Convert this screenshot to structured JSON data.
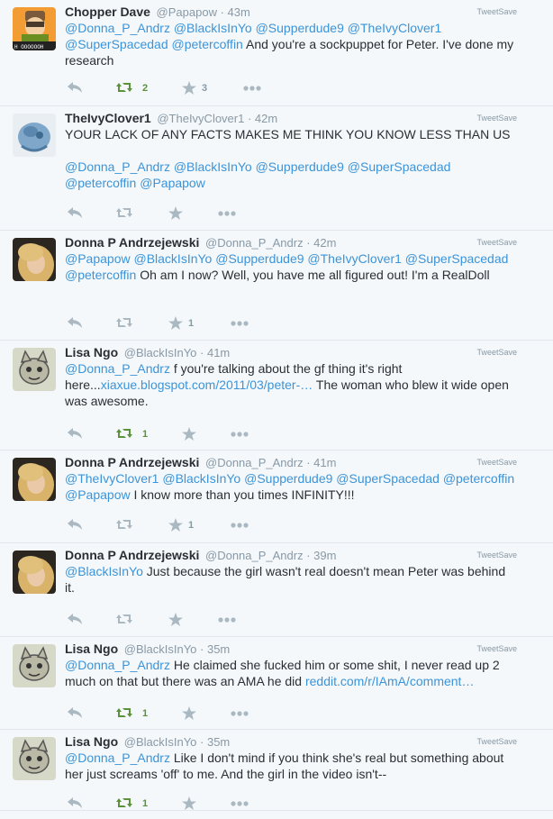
{
  "source_label": "TweetSave",
  "colors": {
    "link": "#3b94d9",
    "retweet_active": "#5c913b",
    "muted": "#aab8c2",
    "background": "#f5f8fa"
  },
  "tweets": [
    {
      "name": "Chopper Dave",
      "handle": "@Papapow",
      "time": "· 43m",
      "avatar": "cartoon-character-orange",
      "avatar_text": "H OOOOOOH",
      "text_parts": [
        {
          "t": "@Donna_P_Andrz",
          "k": "mention"
        },
        {
          "t": " "
        },
        {
          "t": "@BlackIsInYo",
          "k": "mention"
        },
        {
          "t": " "
        },
        {
          "t": "@Supperdude9",
          "k": "mention"
        },
        {
          "t": " "
        },
        {
          "t": "@TheIvyClover1",
          "k": "mention"
        },
        {
          "t": " "
        },
        {
          "t": "@SuperSpacedad",
          "k": "mention"
        },
        {
          "t": " "
        },
        {
          "t": "@petercoffin",
          "k": "mention"
        },
        {
          "t": " And you're a sockpuppet for Peter. I've done my research"
        }
      ],
      "retweets": "2",
      "favorites": "3",
      "retweeted": true
    },
    {
      "name": "TheIvyClover1",
      "handle": "@TheIvyClover1",
      "time": "· 42m",
      "avatar": "blue-sculpture",
      "text_parts": [
        {
          "t": "YOUR LACK OF ANY FACTS MAKES ME THINK YOU KNOW LESS THAN US"
        },
        {
          "t": "\n\n"
        },
        {
          "t": "@Donna_P_Andrz",
          "k": "mention"
        },
        {
          "t": " "
        },
        {
          "t": "@BlackIsInYo",
          "k": "mention"
        },
        {
          "t": " "
        },
        {
          "t": "@Supperdude9",
          "k": "mention"
        },
        {
          "t": " "
        },
        {
          "t": "@SuperSpacedad",
          "k": "mention"
        },
        {
          "t": " "
        },
        {
          "t": "@petercoffin",
          "k": "mention"
        },
        {
          "t": " "
        },
        {
          "t": "@Papapow",
          "k": "mention"
        }
      ],
      "retweets": "",
      "favorites": "",
      "retweeted": false
    },
    {
      "name": "Donna P Andrzejewski",
      "handle": "@Donna_P_Andrz",
      "time": "· 42m",
      "avatar": "blonde-woman-photo",
      "text_parts": [
        {
          "t": "@Papapow",
          "k": "mention"
        },
        {
          "t": " "
        },
        {
          "t": "@BlackIsInYo",
          "k": "mention"
        },
        {
          "t": " "
        },
        {
          "t": "@Supperdude9",
          "k": "mention"
        },
        {
          "t": " "
        },
        {
          "t": "@TheIvyClover1",
          "k": "mention"
        },
        {
          "t": " "
        },
        {
          "t": "@SuperSpacedad",
          "k": "mention"
        },
        {
          "t": " "
        },
        {
          "t": "@petercoffin",
          "k": "mention"
        },
        {
          "t": " Oh am I now? Well, you have me all figured out! I'm a RealDoll"
        }
      ],
      "retweets": "",
      "favorites": "1",
      "retweeted": false
    },
    {
      "name": "Lisa Ngo",
      "handle": "@BlackIsInYo",
      "time": "· 41m",
      "avatar": "cartoon-cat-drawing",
      "text_parts": [
        {
          "t": "@Donna_P_Andrz",
          "k": "mention"
        },
        {
          "t": " f you're talking about the gf thing it's right here..."
        },
        {
          "t": "xiaxue.blogspot.com/2011/03/peter-…",
          "k": "link"
        },
        {
          "t": " The woman who blew it wide open was awesome."
        }
      ],
      "retweets": "1",
      "favorites": "",
      "retweeted": true
    },
    {
      "name": "Donna P Andrzejewski",
      "handle": "@Donna_P_Andrz",
      "time": "· 41m",
      "avatar": "blonde-woman-photo",
      "text_parts": [
        {
          "t": "@TheIvyClover1",
          "k": "mention"
        },
        {
          "t": " "
        },
        {
          "t": "@BlackIsInYo",
          "k": "mention"
        },
        {
          "t": " "
        },
        {
          "t": "@Supperdude9",
          "k": "mention"
        },
        {
          "t": " "
        },
        {
          "t": "@SuperSpacedad",
          "k": "mention"
        },
        {
          "t": " "
        },
        {
          "t": "@petercoffin",
          "k": "mention"
        },
        {
          "t": " "
        },
        {
          "t": "@Papapow",
          "k": "mention"
        },
        {
          "t": " I know more than you times INFINITY!!!"
        }
      ],
      "retweets": "",
      "favorites": "1",
      "retweeted": false
    },
    {
      "name": "Donna P Andrzejewski",
      "handle": "@Donna_P_Andrz",
      "time": "· 39m",
      "avatar": "blonde-woman-photo",
      "text_parts": [
        {
          "t": "@BlackIsInYo",
          "k": "mention"
        },
        {
          "t": " Just because the girl wasn't real doesn't mean Peter was behind it."
        }
      ],
      "retweets": "",
      "favorites": "",
      "retweeted": false
    },
    {
      "name": "Lisa Ngo",
      "handle": "@BlackIsInYo",
      "time": "· 35m",
      "avatar": "cartoon-cat-drawing",
      "text_parts": [
        {
          "t": "@Donna_P_Andrz",
          "k": "mention"
        },
        {
          "t": " He claimed she fucked him or some shit, I never read up 2 much on that but there was an AMA he did "
        },
        {
          "t": "reddit.com/r/IAmA/comment…",
          "k": "link"
        }
      ],
      "retweets": "1",
      "favorites": "",
      "retweeted": true
    },
    {
      "name": "Lisa Ngo",
      "handle": "@BlackIsInYo",
      "time": "· 35m",
      "avatar": "cartoon-cat-drawing",
      "text_parts": [
        {
          "t": "@Donna_P_Andrz",
          "k": "mention"
        },
        {
          "t": " Like I don't mind if you think she's real but something about her just screams 'off' to me. And the girl in the video isn't--"
        }
      ],
      "retweets": "1",
      "favorites": "",
      "retweeted": true
    }
  ]
}
